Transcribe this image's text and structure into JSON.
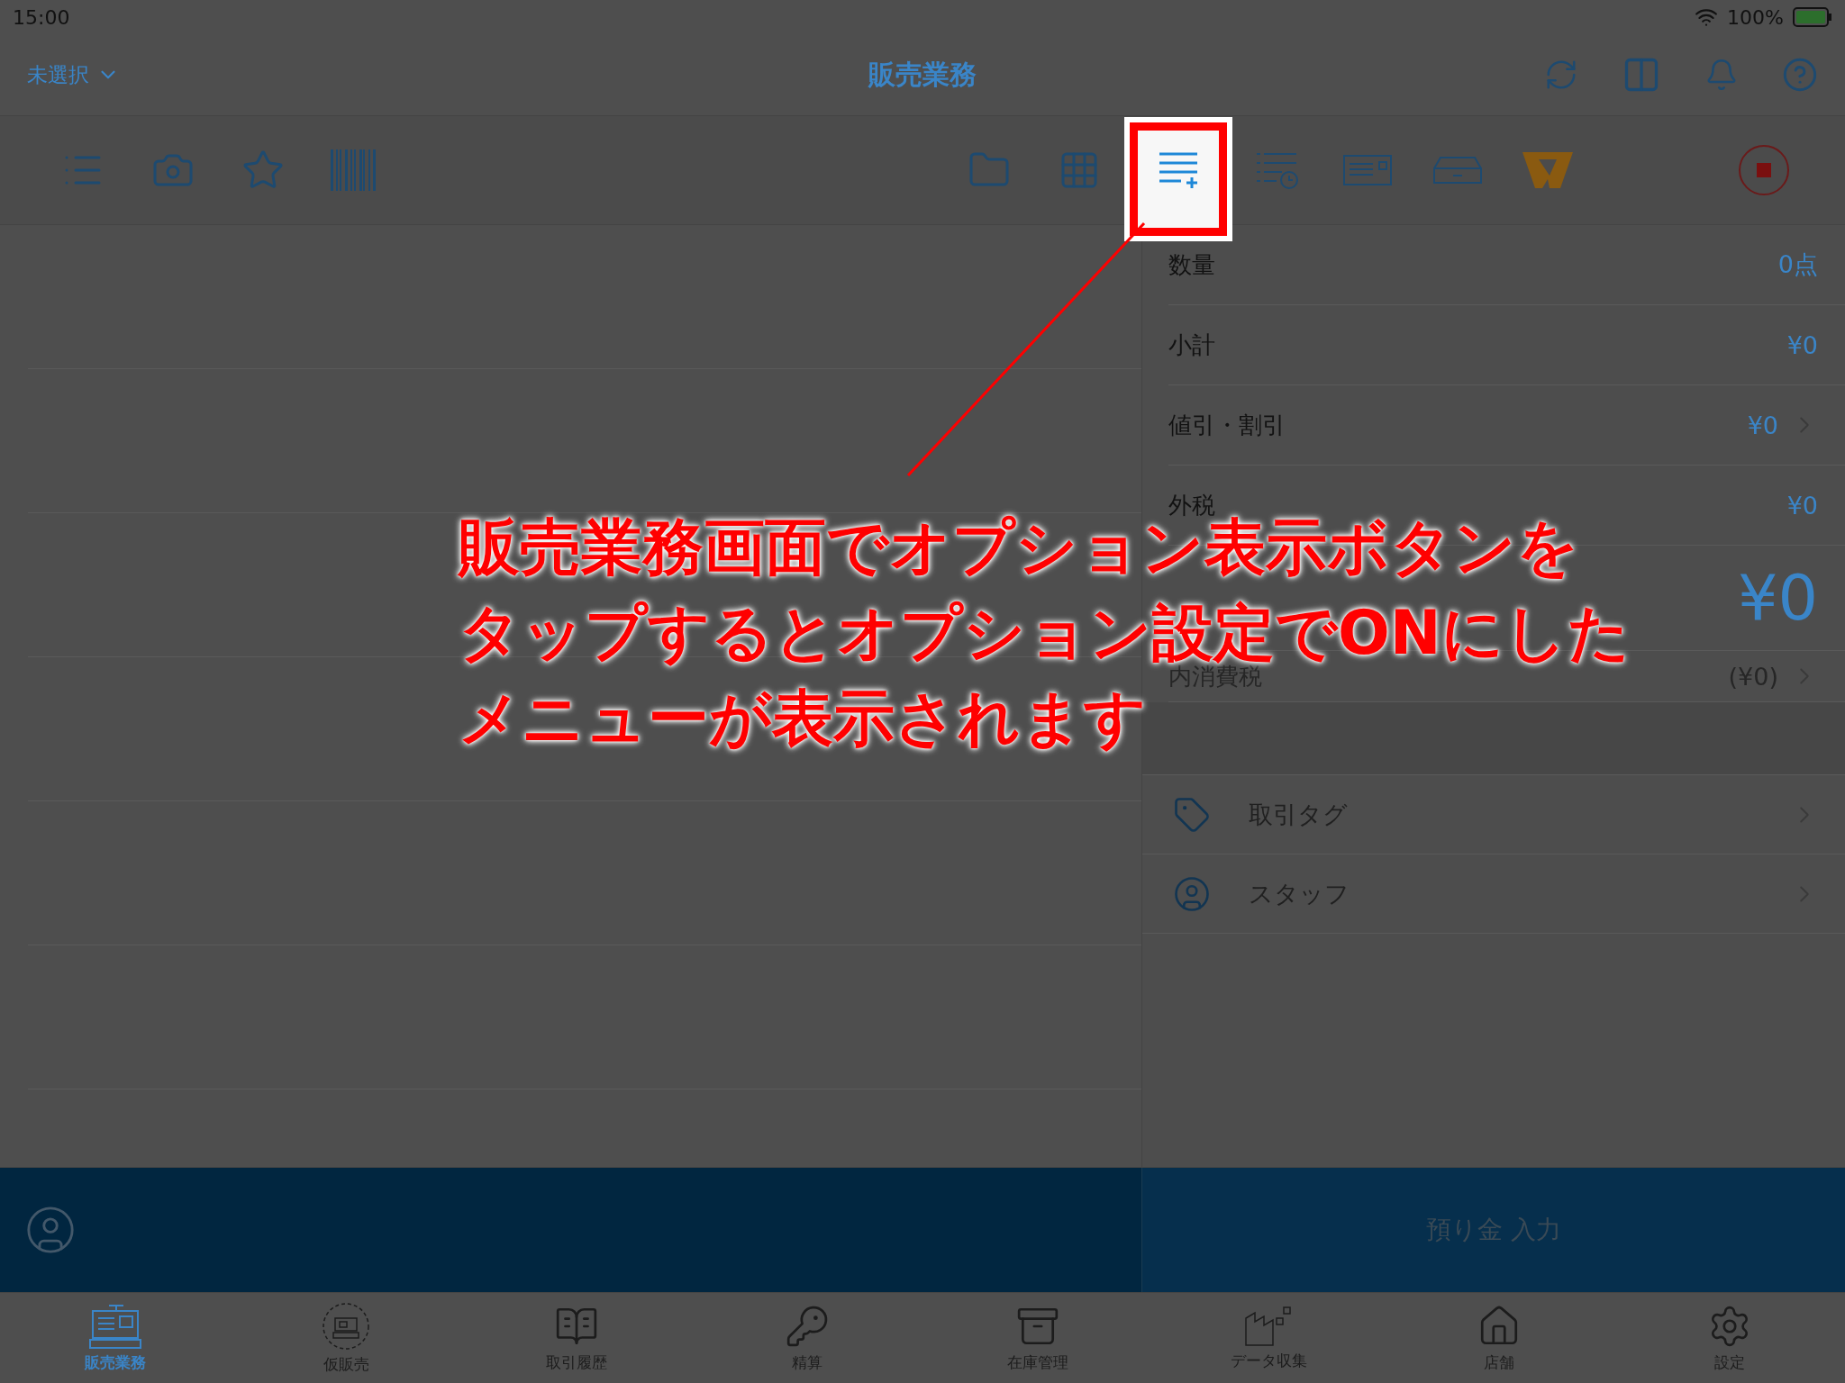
{
  "status_bar": {
    "time": "15:00",
    "battery": "100%"
  },
  "nav_bar": {
    "store_selector": "未選択",
    "title": "販売業務"
  },
  "toolbar": {
    "groups": [
      [
        {
          "kind": "list",
          "highlighted": false
        },
        {
          "kind": "camera",
          "highlighted": false
        },
        {
          "kind": "star",
          "highlighted": false
        },
        {
          "kind": "barcode",
          "highlighted": false
        }
      ],
      [
        {
          "kind": "folder",
          "highlighted": false
        },
        {
          "kind": "grid",
          "highlighted": false
        },
        {
          "kind": "options",
          "highlighted": true
        },
        {
          "kind": "history",
          "highlighted": false
        },
        {
          "kind": "card",
          "highlighted": false
        },
        {
          "kind": "drawer",
          "highlighted": false
        },
        {
          "kind": "logo",
          "highlighted": false
        }
      ],
      [
        {
          "kind": "stop",
          "highlighted": false
        }
      ]
    ]
  },
  "summary": [
    {
      "kind": "row",
      "label": "数量",
      "value": "0点",
      "chevron": false
    },
    {
      "kind": "row",
      "label": "小計",
      "value": "¥0",
      "chevron": false
    },
    {
      "kind": "row",
      "label": "値引・割引",
      "value": "¥0",
      "chevron": true
    },
    {
      "kind": "row",
      "label": "外税",
      "value": "¥0",
      "chevron": false
    },
    {
      "kind": "total",
      "value": "¥0",
      "chevron": false
    },
    {
      "kind": "tax",
      "label": "内消費税",
      "value": "(¥0)",
      "chevron": true
    }
  ],
  "options": [
    {
      "kind": "tag",
      "label": "取引タグ"
    },
    {
      "kind": "staff",
      "label": "スタッフ"
    }
  ],
  "deposit_button": "預り金 入力",
  "tabs": [
    {
      "label": "販売業務",
      "selected": true
    },
    {
      "label": "仮販売",
      "selected": false
    },
    {
      "label": "取引履歴",
      "selected": false
    },
    {
      "label": "精算",
      "selected": false
    },
    {
      "label": "在庫管理",
      "selected": false
    },
    {
      "label": "データ収集",
      "selected": false
    },
    {
      "label": "店舗",
      "selected": false
    },
    {
      "label": "設定",
      "selected": false
    }
  ],
  "annotation": {
    "lines": [
      "販売業務画面でオプション表示ボタンを",
      "タップするとオプション設定でONにした",
      "メニューが表示されます"
    ]
  }
}
